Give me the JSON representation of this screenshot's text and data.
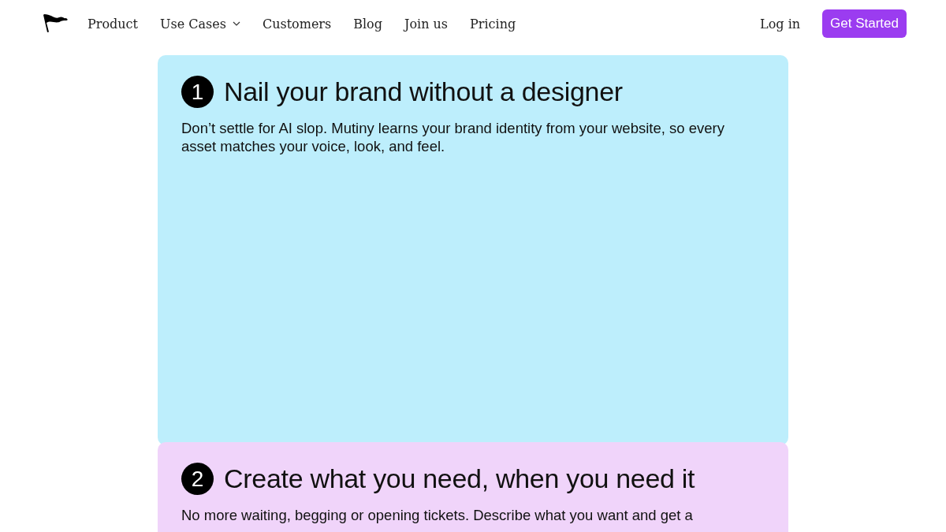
{
  "nav": {
    "links": [
      {
        "label": "Product",
        "dropdown": false
      },
      {
        "label": "Use Cases",
        "dropdown": true
      },
      {
        "label": "Customers",
        "dropdown": false
      },
      {
        "label": "Blog",
        "dropdown": false
      },
      {
        "label": "Join us",
        "dropdown": false
      },
      {
        "label": "Pricing",
        "dropdown": false
      }
    ],
    "login": "Log in",
    "cta": "Get Started"
  },
  "steps": [
    {
      "number": "1",
      "title": "Nail your brand without a designer",
      "description": "Don’t settle for AI slop. Mutiny learns your brand identity from your website, so every asset matches your voice, look, and feel.",
      "color": "#bdeefc"
    },
    {
      "number": "2",
      "title": "Create what you need, when you need it",
      "description": "No more waiting, begging or opening tickets. Describe what you want and get a",
      "color": "#f0d4fa"
    }
  ]
}
